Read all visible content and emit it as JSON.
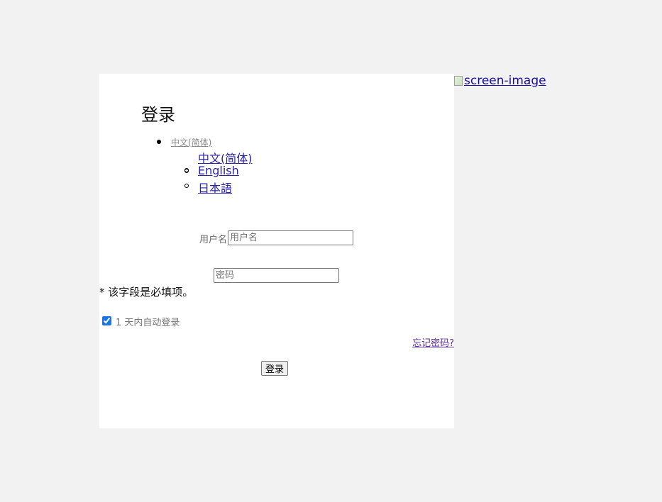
{
  "login": {
    "title": "登录",
    "language_current": "中文(简体)",
    "languages": [
      "中文(简体)",
      "English",
      "日本語"
    ],
    "username_label": "用户名",
    "username_placeholder": "用户名",
    "username_value": "",
    "password_placeholder": "密码",
    "password_value": "",
    "required_note": "* 该字段是必填项。",
    "remember_checked": true,
    "remember_label": "1 天内自动登录",
    "forgot_link": "忘记密码?",
    "submit_label": "登录"
  },
  "screen_image": {
    "alt_text": "screen-image",
    "icon": "broken-image-icon"
  },
  "colors": {
    "background": "#f2f2f2",
    "panel": "#ffffff",
    "link": "#2a23a8",
    "checkbox_accent": "#1a73e8"
  }
}
